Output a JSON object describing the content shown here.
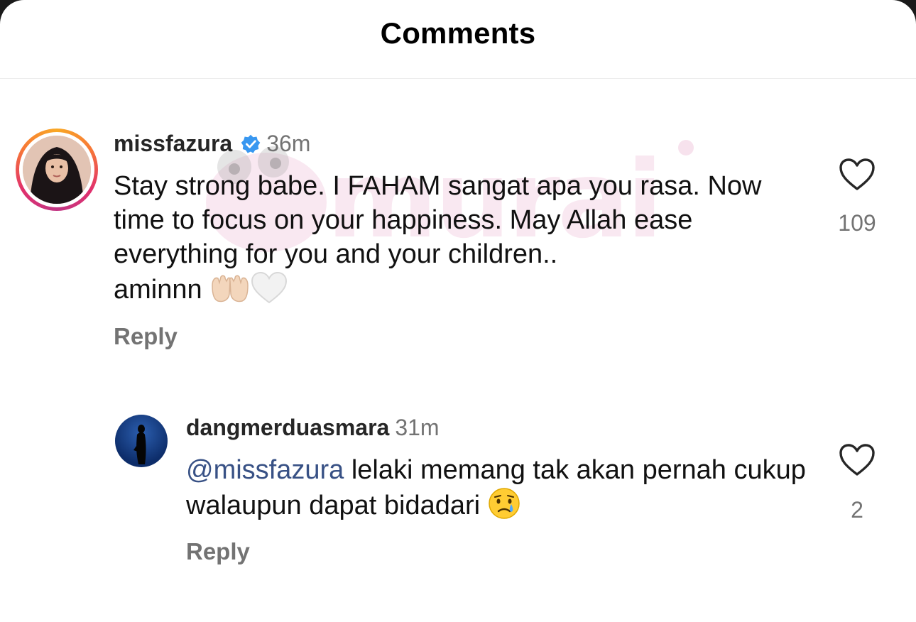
{
  "header": {
    "title": "Comments"
  },
  "watermark": {
    "text": "murai"
  },
  "comments": [
    {
      "username": "missfazura",
      "verified": true,
      "time": "36m",
      "text": "Stay strong babe. I FAHAM sangat apa you rasa. Now time to focus on your happiness. May Allah ease everything for you and your children..",
      "text_tail": "aminnn",
      "emojis": [
        "palms-up-together",
        "white-heart"
      ],
      "like_count": "109",
      "reply_label": "Reply",
      "has_story_ring": true
    },
    {
      "username": "dangmerduasmara",
      "verified": false,
      "time": "31m",
      "mention": "@missfazura",
      "text": " lelaki memang tak akan pernah cukup walaupun dapat bidadari",
      "emojis": [
        "crying-face"
      ],
      "like_count": "2",
      "reply_label": "Reply",
      "has_story_ring": false
    }
  ],
  "colors": {
    "link": "#385185",
    "muted": "#737373",
    "verified": "#3897f0"
  }
}
